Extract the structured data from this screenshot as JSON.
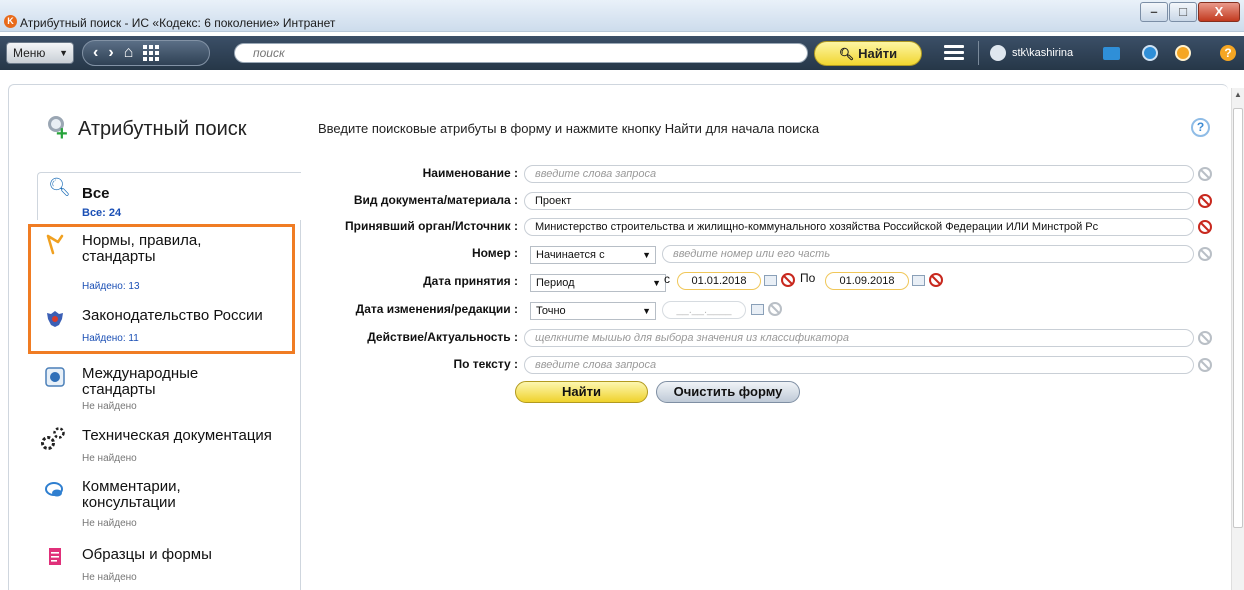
{
  "window": {
    "title": "Атрибутный поиск - ИС «Кодекс: 6 поколение» Интранет",
    "app_icon": "K",
    "controls": {
      "minimize": "–",
      "maximize": "□",
      "close": "X"
    }
  },
  "toolbar": {
    "menu_label": "Меню",
    "search_placeholder": "поиск",
    "find_label": "Найти",
    "user_name": "stk\\kashirina",
    "help_glyph": "?"
  },
  "sidebar": {
    "title": "Атрибутный поиск",
    "all": {
      "label": "Все",
      "count": "Все: 24"
    },
    "categories": [
      {
        "label_line1": "Нормы, правила,",
        "label_line2": "стандарты",
        "status": "Найдено: 13",
        "icon": "norms-icon"
      },
      {
        "label_line1": "Законодательство России",
        "label_line2": "",
        "status": "Найдено: 11",
        "icon": "russia-emblem-icon"
      },
      {
        "label_line1": "Международные",
        "label_line2": "стандарты",
        "status": "Не найдено",
        "icon": "international-standards-icon"
      },
      {
        "label_line1": "Техническая документация",
        "label_line2": "",
        "status": "Не найдено",
        "icon": "gears-icon"
      },
      {
        "label_line1": "Комментарии,",
        "label_line2": "консультации",
        "status": "Не найдено",
        "icon": "comments-icon"
      },
      {
        "label_line1": "Образцы и формы",
        "label_line2": "",
        "status": "Не найдено",
        "icon": "forms-icon"
      }
    ]
  },
  "form": {
    "instructions": "Введите поисковые атрибуты в форму и нажмите кнопку Найти для начала поиска",
    "help_glyph": "?",
    "name": {
      "label": "Наименование :",
      "placeholder": "введите слова запроса"
    },
    "doc_type": {
      "label": "Вид документа/материала :",
      "value": "Проект"
    },
    "issuer": {
      "label": "Принявший орган/Источник :",
      "value": "Министерство строительства и жилищно-коммунального хозяйства Российской Федерации ИЛИ Минстрой Рс"
    },
    "number": {
      "label": "Номер :",
      "mode": "Начинается с",
      "placeholder": "введите номер или его часть"
    },
    "date_adopted": {
      "label": "Дата принятия :",
      "mode": "Период",
      "from_label": "с",
      "from": "01.01.2018",
      "to_label": "По",
      "to": "01.09.2018"
    },
    "date_changed": {
      "label": "Дата изменения/редакции :",
      "mode": "Точно",
      "value": "__.__.____"
    },
    "status": {
      "label": "Действие/Актуальность :",
      "placeholder": "щелкните мышью для выбора значения из классификатора"
    },
    "text": {
      "label": "По тексту :",
      "placeholder": "введите слова запроса"
    },
    "find_button": "Найти",
    "clear_button": "Очистить форму"
  },
  "colors": {
    "toolbar_bg": "#2d4054",
    "find_button": "#f1d630",
    "highlight_box": "#f07c23",
    "found_text": "#1a4fb5",
    "clear_red": "#c8281e"
  }
}
